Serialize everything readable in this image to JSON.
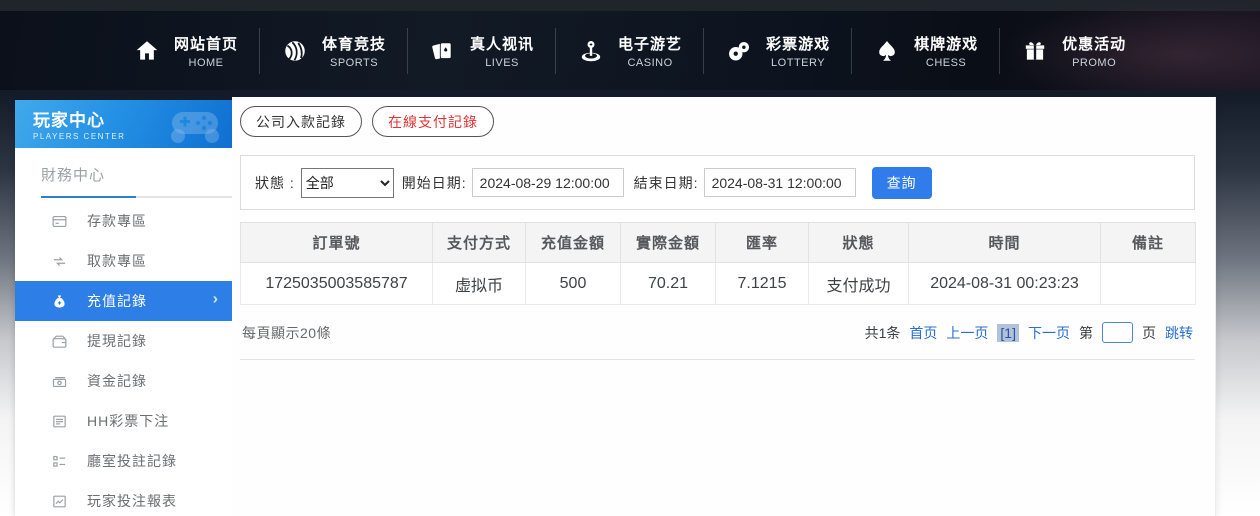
{
  "nav": {
    "items": [
      {
        "zh": "网站首页",
        "en": "HOME",
        "icon": "home-icon"
      },
      {
        "zh": "体育竞技",
        "en": "SPORTS",
        "icon": "sports-ball-icon"
      },
      {
        "zh": "真人视讯",
        "en": "LIVES",
        "icon": "playing-cards-icon"
      },
      {
        "zh": "电子游艺",
        "en": "CASINO",
        "icon": "joystick-icon"
      },
      {
        "zh": "彩票游戏",
        "en": "LOTTERY",
        "icon": "lottery-balls-icon"
      },
      {
        "zh": "棋牌游戏",
        "en": "CHESS",
        "icon": "spade-icon"
      },
      {
        "zh": "优惠活动",
        "en": "PROMO",
        "icon": "gift-icon"
      }
    ]
  },
  "sidebar": {
    "title_zh": "玩家中心",
    "title_en": "PLAYERS CENTER",
    "section_title": "財務中心",
    "items": [
      {
        "label": "存款專區"
      },
      {
        "label": "取款專區"
      },
      {
        "label": "充值記錄",
        "active": true
      },
      {
        "label": "提現記錄"
      },
      {
        "label": "資金記錄"
      },
      {
        "label": "HH彩票下注"
      },
      {
        "label": "廳室投註記錄"
      },
      {
        "label": "玩家投注報表"
      }
    ]
  },
  "tabs": [
    {
      "label": "公司入款記錄",
      "active": false
    },
    {
      "label": "在線支付記錄",
      "active": true
    }
  ],
  "filter": {
    "status_label": "狀態 :",
    "status_value": "全部",
    "start_label": "開始日期:",
    "start_value": "2024-08-29 12:00:00",
    "end_label": "結束日期:",
    "end_value": "2024-08-31 12:00:00",
    "search_label": "查詢"
  },
  "table": {
    "headers": [
      "訂單號",
      "支付方式",
      "充值金額",
      "實際金額",
      "匯率",
      "狀態",
      "時間",
      "備註"
    ],
    "rows": [
      [
        "1725035003585787",
        "虚拟币",
        "500",
        "70.21",
        "7.1215",
        "支付成功",
        "2024-08-31 00:23:23",
        ""
      ]
    ]
  },
  "pagination": {
    "per_page": "每頁顯示20條",
    "total": "共1条",
    "first": "首页",
    "prev": "上一页",
    "current": "[1]",
    "next": "下一页",
    "jump_prefix": "第",
    "jump_suffix": "页",
    "jump": "跳转",
    "jump_value": ""
  },
  "colors": {
    "accent_blue": "#2e7ee8",
    "active_tab_red": "#e13434",
    "link_blue": "#2a6dd0",
    "sidebar_header_blue": "#2490e4",
    "success_text": "#3f4247"
  }
}
